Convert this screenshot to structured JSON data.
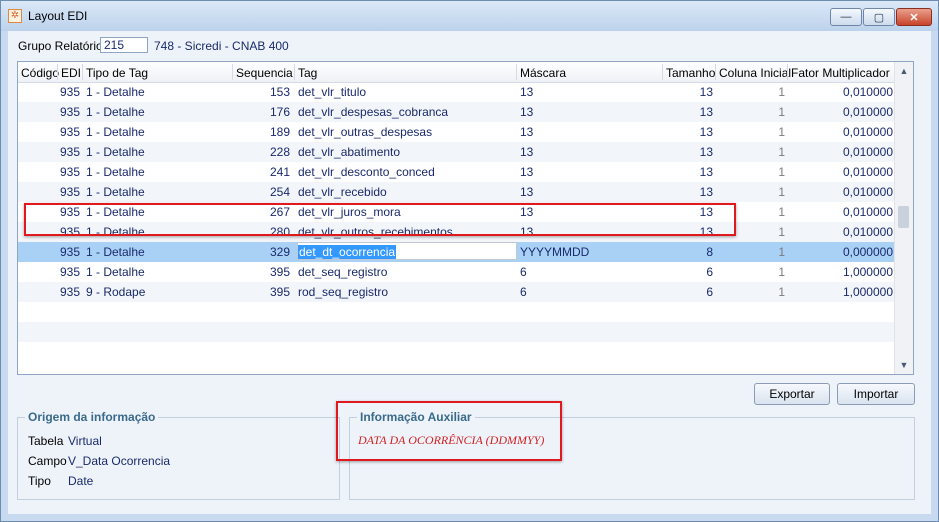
{
  "window": {
    "title": "Layout EDI",
    "min_label": "—",
    "max_label": "▢",
    "close_label": "✕"
  },
  "grupo": {
    "label": "Grupo Relatório",
    "value": "215",
    "description": "748 - Sicredi - CNAB 400"
  },
  "grid": {
    "columns": [
      "Código",
      "EDI",
      "Tipo de Tag",
      "Sequencia",
      "Tag",
      "Máscara",
      "Tamanho",
      "Coluna Inicial",
      "Fator Multiplicador"
    ],
    "rows": [
      {
        "codigo": "",
        "edi": "935",
        "tipo": "1 - Detalhe",
        "seq": "153",
        "tag": "det_vlr_titulo",
        "mascara": "13",
        "tam": "13",
        "col": "1",
        "fator": "0,010000"
      },
      {
        "codigo": "",
        "edi": "935",
        "tipo": "1 - Detalhe",
        "seq": "176",
        "tag": "det_vlr_despesas_cobranca",
        "mascara": "13",
        "tam": "13",
        "col": "1",
        "fator": "0,010000"
      },
      {
        "codigo": "",
        "edi": "935",
        "tipo": "1 - Detalhe",
        "seq": "189",
        "tag": "det_vlr_outras_despesas",
        "mascara": "13",
        "tam": "13",
        "col": "1",
        "fator": "0,010000"
      },
      {
        "codigo": "",
        "edi": "935",
        "tipo": "1 - Detalhe",
        "seq": "228",
        "tag": "det_vlr_abatimento",
        "mascara": "13",
        "tam": "13",
        "col": "1",
        "fator": "0,010000"
      },
      {
        "codigo": "",
        "edi": "935",
        "tipo": "1 - Detalhe",
        "seq": "241",
        "tag": "det_vlr_desconto_conced",
        "mascara": "13",
        "tam": "13",
        "col": "1",
        "fator": "0,010000"
      },
      {
        "codigo": "",
        "edi": "935",
        "tipo": "1 - Detalhe",
        "seq": "254",
        "tag": "det_vlr_recebido",
        "mascara": "13",
        "tam": "13",
        "col": "1",
        "fator": "0,010000"
      },
      {
        "codigo": "",
        "edi": "935",
        "tipo": "1 - Detalhe",
        "seq": "267",
        "tag": "det_vlr_juros_mora",
        "mascara": "13",
        "tam": "13",
        "col": "1",
        "fator": "0,010000"
      },
      {
        "codigo": "",
        "edi": "935",
        "tipo": "1 - Detalhe",
        "seq": "280",
        "tag": "det_vlr_outros_recebimentos",
        "mascara": "13",
        "tam": "13",
        "col": "1",
        "fator": "0,010000"
      },
      {
        "codigo": "",
        "edi": "935",
        "tipo": "1 - Detalhe",
        "seq": "329",
        "tag": "det_dt_ocorrencia",
        "mascara": "YYYYMMDD",
        "tam": "8",
        "col": "1",
        "fator": "0,000000"
      },
      {
        "codigo": "",
        "edi": "935",
        "tipo": "1 - Detalhe",
        "seq": "395",
        "tag": "det_seq_registro",
        "mascara": "6",
        "tam": "6",
        "col": "1",
        "fator": "1,000000"
      },
      {
        "codigo": "",
        "edi": "935",
        "tipo": "9 - Rodape",
        "seq": "395",
        "tag": "rod_seq_registro",
        "mascara": "6",
        "tam": "6",
        "col": "1",
        "fator": "1,000000"
      }
    ]
  },
  "buttons": {
    "exportar": "Exportar",
    "importar": "Importar"
  },
  "origem": {
    "title": "Origem da informação",
    "tabela_label": "Tabela",
    "tabela_value": "Virtual",
    "campo_label": "Campo",
    "campo_value": "V_Data Ocorrencia",
    "tipo_label": "Tipo",
    "tipo_value": "Date"
  },
  "auxiliar": {
    "title": "Informação Auxiliar",
    "text": "DATA DA OCORRÊNCIA  (DDMMYY)"
  },
  "colors": {
    "accent": "#3399ff",
    "selected_row": "#a9d0f5",
    "highlight": "#e0191e",
    "aux_text": "#d22222"
  }
}
